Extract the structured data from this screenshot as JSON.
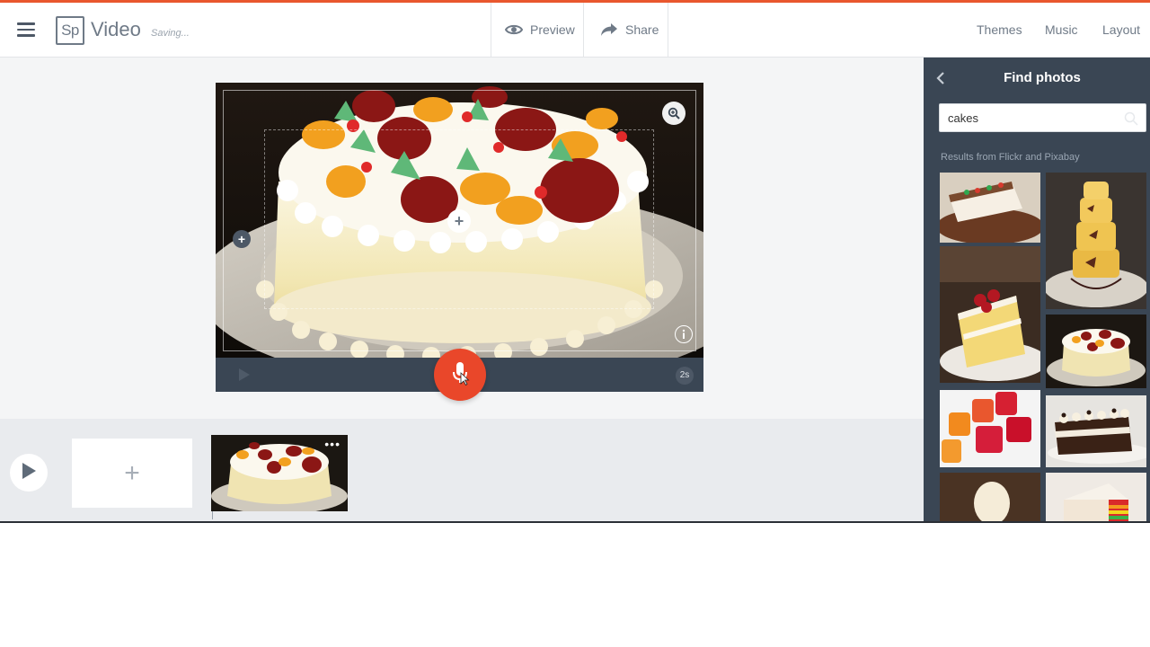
{
  "header": {
    "logo": "Sp",
    "app_title": "Video",
    "status": "Saving...",
    "preview_label": "Preview",
    "share_label": "Share",
    "themes_label": "Themes",
    "music_label": "Music",
    "layout_label": "Layout"
  },
  "stage": {
    "duration_label": "2s",
    "plus_glyph": "+"
  },
  "timeline": {
    "add_glyph": "+",
    "more_glyph": "•••"
  },
  "panel": {
    "title": "Find photos",
    "search_value": "cakes",
    "results_label": "Results from Flickr and Pixabay"
  },
  "colors": {
    "accent": "#e9472a",
    "panel_bg": "#3a4654",
    "header_text": "#6f7a87"
  },
  "icons": [
    "menu-icon",
    "eye-icon",
    "share-arrow-icon",
    "zoom-in-icon",
    "info-icon",
    "microphone-icon",
    "play-icon",
    "chevron-left-icon",
    "search-icon"
  ]
}
